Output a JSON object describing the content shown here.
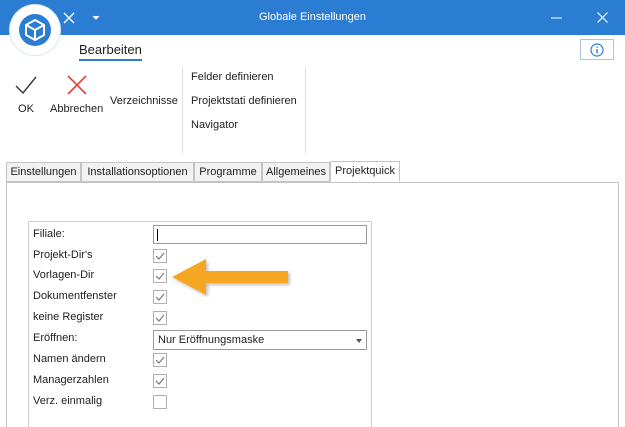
{
  "window": {
    "title": "Globale Einstellungen"
  },
  "ribbon": {
    "tab_label": "Bearbeiten",
    "ok_label": "OK",
    "cancel_label": "Abbrechen",
    "directories_label": "Verzeichnisse",
    "small_items": [
      "Felder definieren",
      "Projektstati definieren",
      "Navigator"
    ]
  },
  "tabs": [
    "Einstellungen",
    "Installationsoptionen",
    "Programme",
    "Allgemeines",
    "Projektquick"
  ],
  "active_tab": "Projektquick",
  "form": {
    "filiale_label": "Filiale:",
    "filiale_value": "",
    "projekt_dirs_label": "Projekt-Dir's",
    "projekt_dirs_checked": true,
    "vorlagen_dir_label": "Vorlagen-Dir",
    "vorlagen_dir_checked": true,
    "dokumentfenster_label": "Dokumentfenster",
    "dokumentfenster_checked": true,
    "keine_register_label": "keine Register",
    "keine_register_checked": true,
    "eroeffnen_label": "Eröffnen:",
    "eroeffnen_value": "Nur Eröffnungsmaske",
    "namen_aendern_label": "Namen ändern",
    "namen_aendern_checked": true,
    "managerzahlen_label": "Managerzahlen",
    "managerzahlen_checked": true,
    "verz_einmalig_label": "Verz. einmalig",
    "verz_einmalig_checked": false
  },
  "colors": {
    "titlebar": "#2b7cd3",
    "annotation_arrow": "#f5a623",
    "cancel_icon": "#e0443e"
  }
}
